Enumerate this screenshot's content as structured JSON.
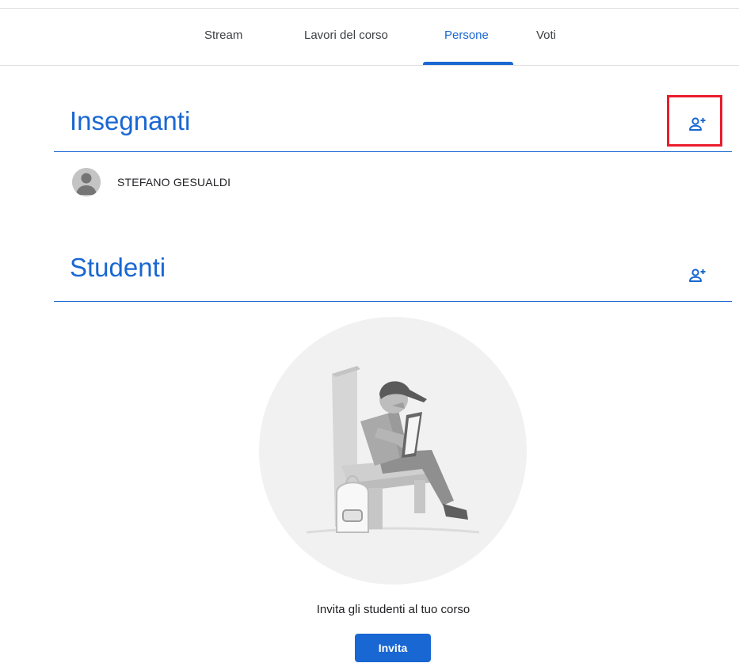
{
  "nav": {
    "tabs": [
      {
        "label": "Stream"
      },
      {
        "label": "Lavori del corso"
      },
      {
        "label": "Persone",
        "active": true
      },
      {
        "label": "Voti"
      }
    ]
  },
  "teachers": {
    "title": "Insegnanti",
    "add_icon": "person-add-icon",
    "people": [
      {
        "name": "STEFANO GESUALDI",
        "avatar_icon": "default-avatar-icon"
      }
    ]
  },
  "students": {
    "title": "Studenti",
    "add_icon": "person-add-icon",
    "empty_message": "Invita gli studenti al tuo corso",
    "invite_label": "Invita",
    "illustration": "student-reading-illustration"
  },
  "colors": {
    "accent": "#1967d2",
    "highlight": "#ea1d2c",
    "text": "#202124",
    "divider": "#e0e0e0"
  }
}
